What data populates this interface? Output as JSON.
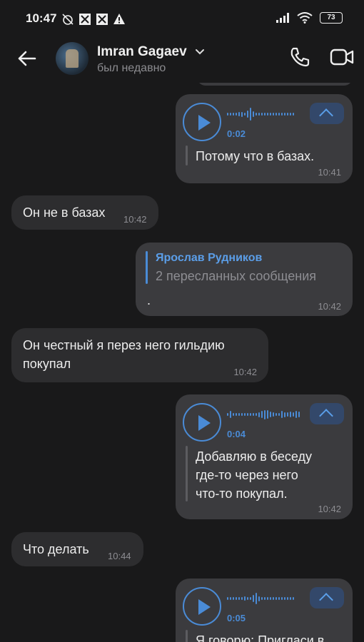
{
  "status_bar": {
    "time": "10:47",
    "battery": "73"
  },
  "header": {
    "name": "Imran Gagaev",
    "status": "был недавно"
  },
  "messages": [
    {
      "duration": "0:02",
      "text": "Потому что в базах.",
      "time": "10:41"
    },
    {
      "text": "Он не в базах",
      "time": "10:42"
    },
    {
      "fwd_name": "Ярослав Рудников",
      "fwd_sub": "2 пересланных сообщения",
      "text": ".",
      "time": "10:42"
    },
    {
      "text_line1": "Он честный я перез него гильдию",
      "text_line2": "покупал",
      "time": "10:42"
    },
    {
      "duration": "0:04",
      "text_line1": "Добавляю в беседу",
      "text_line2": "где-то через него",
      "text_line3": "что-то покупал.",
      "time": "10:42"
    },
    {
      "text": "Что делать",
      "time": "10:44"
    },
    {
      "duration": "0:05",
      "text": "Я говорю: Пригласи в"
    }
  ],
  "colors": {
    "background": "#19191a",
    "bubble_in": "#2d2d2f",
    "bubble_out": "#3b3b3e",
    "accent": "#4a8bd6"
  }
}
